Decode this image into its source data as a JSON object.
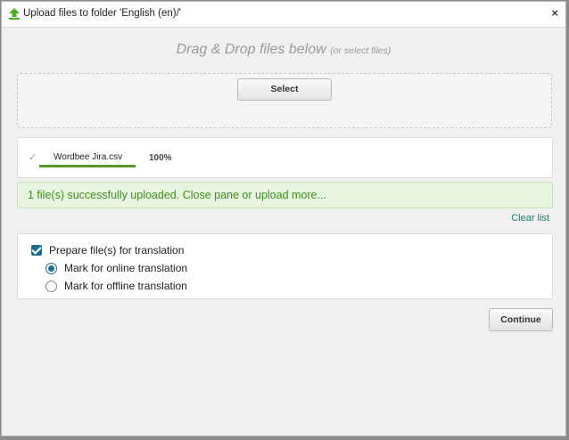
{
  "window": {
    "title": "Upload files to folder 'English (en)/'",
    "close_symbol": "×",
    "icon": "upload-arrow-icon"
  },
  "dropzone": {
    "heading": "Drag & Drop files below",
    "subheading": "(or select files)",
    "select_label": "Select"
  },
  "files": [
    {
      "check": "✓",
      "name": "Wordbee Jira.csv",
      "progress_text": "100%",
      "progress": 1.0
    }
  ],
  "status": {
    "message": "1 file(s) successfully uploaded. Close pane or upload more...",
    "clear_list": "Clear list"
  },
  "options": {
    "prepare_label": "Prepare file(s) for translation",
    "prepare_checked": true,
    "online_label": "Mark for online translation",
    "offline_label": "Mark for offline translation",
    "selected": "online"
  },
  "actions": {
    "continue_label": "Continue"
  },
  "colors": {
    "accent": "#1e6f8a",
    "success_text": "#3f8f1e",
    "success_bg": "#e8f5e1",
    "progress": "#5a9a2b",
    "link": "#2a7a6a"
  }
}
